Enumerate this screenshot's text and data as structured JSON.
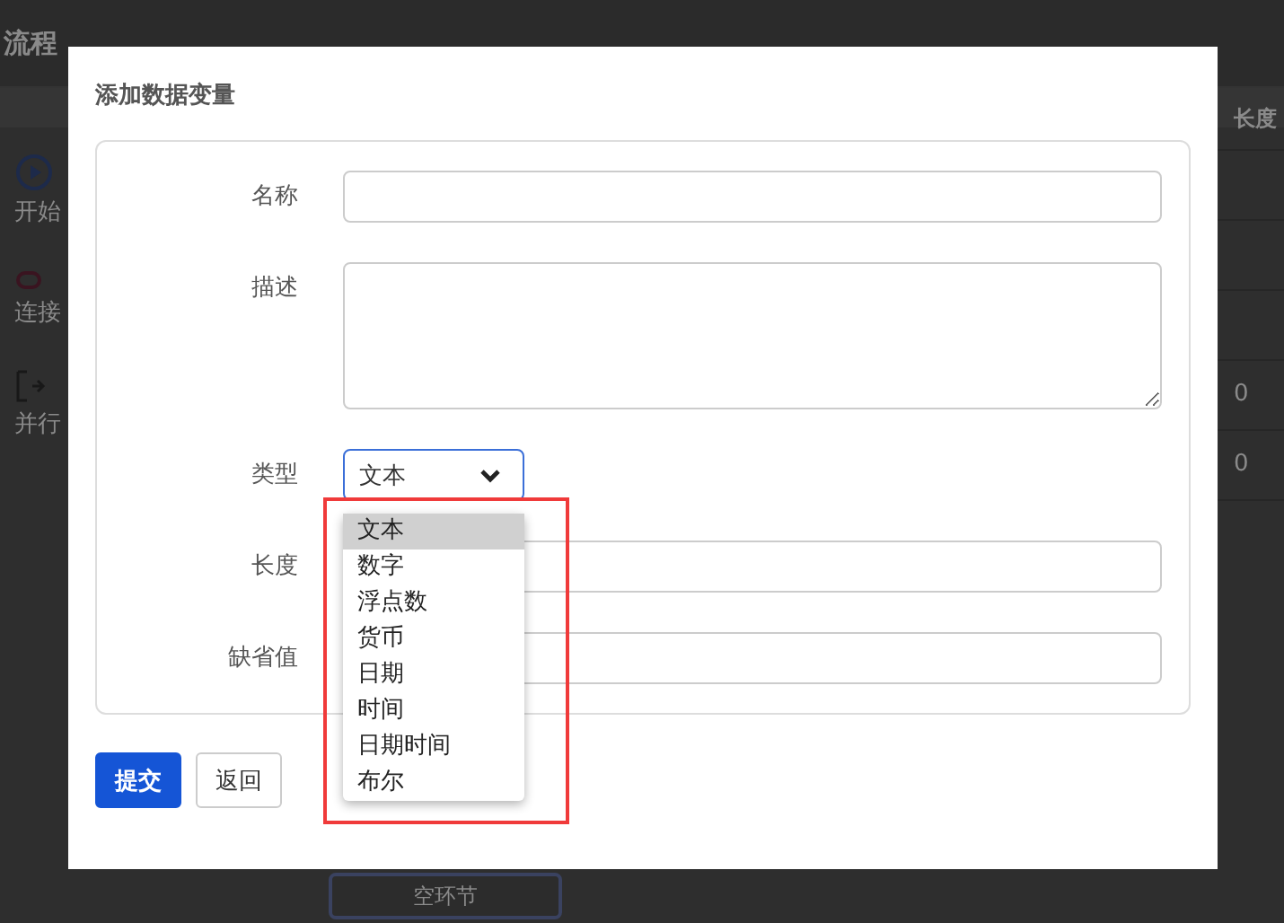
{
  "background": {
    "title": "流程",
    "palette": [
      {
        "label": "开始"
      },
      {
        "label": "连接"
      },
      {
        "label": "并行"
      }
    ],
    "table": {
      "columns": [
        "长度"
      ],
      "rows": [
        {
          "cells": [
            "0"
          ]
        },
        {
          "cells": [
            "0"
          ]
        }
      ]
    },
    "node": {
      "label": "空环节"
    }
  },
  "dialog": {
    "title": "添加数据变量",
    "fields": [
      {
        "kind": "input",
        "label": "名称"
      },
      {
        "kind": "textarea",
        "label": "描述"
      },
      {
        "kind": "select",
        "label": "类型",
        "value": "文本",
        "open": true,
        "options": [
          {
            "label": "文本",
            "selected": true
          },
          {
            "label": "数字",
            "selected": false
          },
          {
            "label": "浮点数",
            "selected": false
          },
          {
            "label": "货币",
            "selected": false
          },
          {
            "label": "日期",
            "selected": false
          },
          {
            "label": "时间",
            "selected": false
          },
          {
            "label": "日期时间",
            "selected": false
          },
          {
            "label": "布尔",
            "selected": false
          }
        ]
      },
      {
        "kind": "input",
        "label": "长度"
      },
      {
        "kind": "input",
        "label": "缺省值"
      }
    ],
    "buttons": [
      {
        "label": "提交",
        "kind": "primary"
      },
      {
        "label": "返回",
        "kind": "default"
      }
    ],
    "highlight": true
  }
}
